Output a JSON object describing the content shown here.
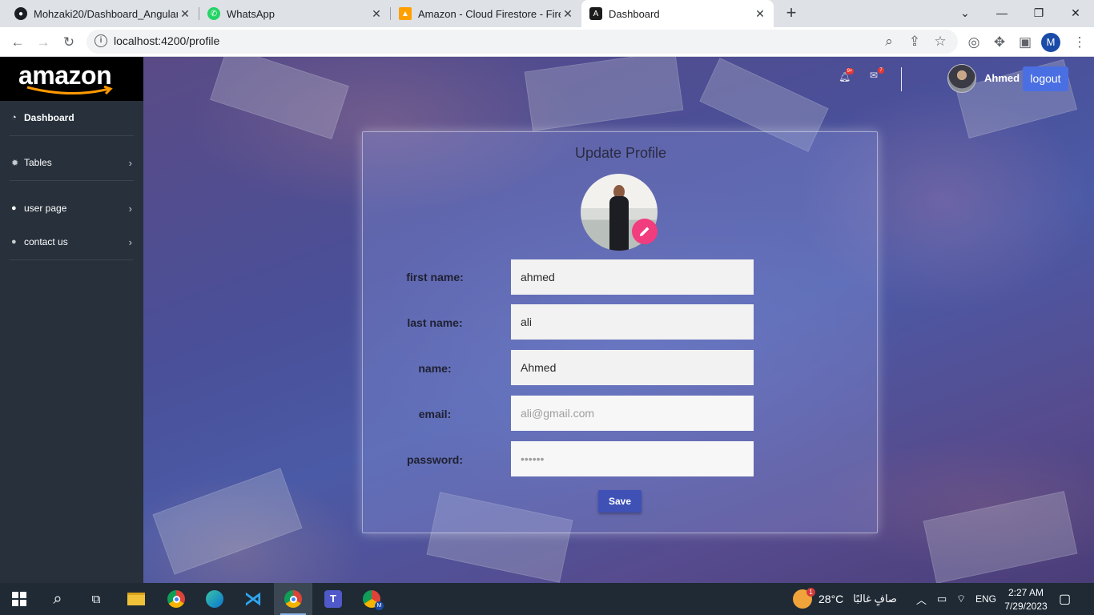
{
  "browser": {
    "tabs": [
      {
        "title": "Mohzaki20/Dashboard_Angular",
        "icon": "github-icon"
      },
      {
        "title": "WhatsApp",
        "icon": "whatsapp-icon"
      },
      {
        "title": "Amazon - Cloud Firestore - Fireb",
        "icon": "firebase-icon"
      },
      {
        "title": "Dashboard",
        "icon": "angular-icon",
        "active": true
      }
    ],
    "url": "localhost:4200/profile",
    "profile_initial": "M"
  },
  "sidebar": {
    "logo": "amazon",
    "items": [
      {
        "label": "Dashboard",
        "icon": "dashboard-icon",
        "active": true
      },
      {
        "label": "Tables",
        "icon": "gear-icon"
      },
      {
        "label": "user page",
        "icon": "user-icon"
      },
      {
        "label": "contact us",
        "icon": "users-icon"
      }
    ]
  },
  "header": {
    "notifications_badge": "9+",
    "mail_badge": "7",
    "user_name": "Ahmed",
    "logout_label": "logout"
  },
  "profile": {
    "title": "Update Profile",
    "fields": [
      {
        "label": "first name:",
        "value": "ahmed",
        "placeholder": ""
      },
      {
        "label": "last name:",
        "value": "ali",
        "placeholder": ""
      },
      {
        "label": "name:",
        "value": "Ahmed",
        "placeholder": ""
      },
      {
        "label": "email:",
        "value": "",
        "placeholder": "ali@gmail.com"
      },
      {
        "label": "password:",
        "value": "",
        "placeholder": "••••••"
      }
    ],
    "save_label": "Save"
  },
  "taskbar": {
    "weather_badge": "1",
    "temperature": "28°C",
    "weather_text": "صافٍ غالبًا",
    "language": "ENG",
    "time": "2:27 AM",
    "date": "7/29/2023",
    "app_badge": "M"
  },
  "colors": {
    "accent": "#4a6fe3",
    "save": "#3f51b5",
    "edit_fab": "#f13c7e",
    "sidebar": "#27303b",
    "taskbar": "#1f2a35"
  }
}
